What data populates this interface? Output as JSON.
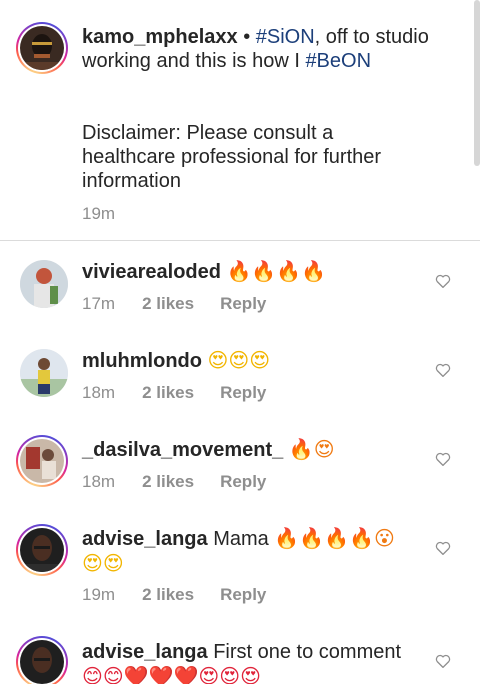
{
  "caption": {
    "username": "kamo_mphelaxx",
    "separator": " • ",
    "hashtag1": "#SiON",
    "text1": ", off to studio working and this is how I ",
    "hashtag2": "#BeON",
    "disclaimer": "Disclaimer: Please consult a healthcare professional for further information",
    "time": "19m"
  },
  "comments": [
    {
      "username": "viviearealoded",
      "text": "",
      "emoji": "🔥🔥🔥🔥",
      "time": "17m",
      "likes": "2 likes",
      "reply": "Reply"
    },
    {
      "username": "mluhmlondo",
      "text": "",
      "emoji": "😍😍😍",
      "time": "18m",
      "likes": "2 likes",
      "reply": "Reply"
    },
    {
      "username": "_dasilva_movement_",
      "text": "",
      "emoji": "🔥😍",
      "time": "18m",
      "likes": "2 likes",
      "reply": "Reply"
    },
    {
      "username": "advise_langa",
      "text": "Mama",
      "emoji": "🔥🔥🔥🔥😮",
      "emoji2": "😍😍",
      "time": "19m",
      "likes": "2 likes",
      "reply": "Reply"
    },
    {
      "username": "advise_langa",
      "text": "First one to comment",
      "emoji": "😊😊❤️❤️❤️😍😍😍",
      "time": "",
      "likes": "",
      "reply": ""
    }
  ],
  "icons": {
    "like": "heart-outline-icon"
  },
  "colors": {
    "hashtag": "#1c3f7a",
    "meta": "#8e8e8e",
    "divider": "#dbdbdb"
  }
}
